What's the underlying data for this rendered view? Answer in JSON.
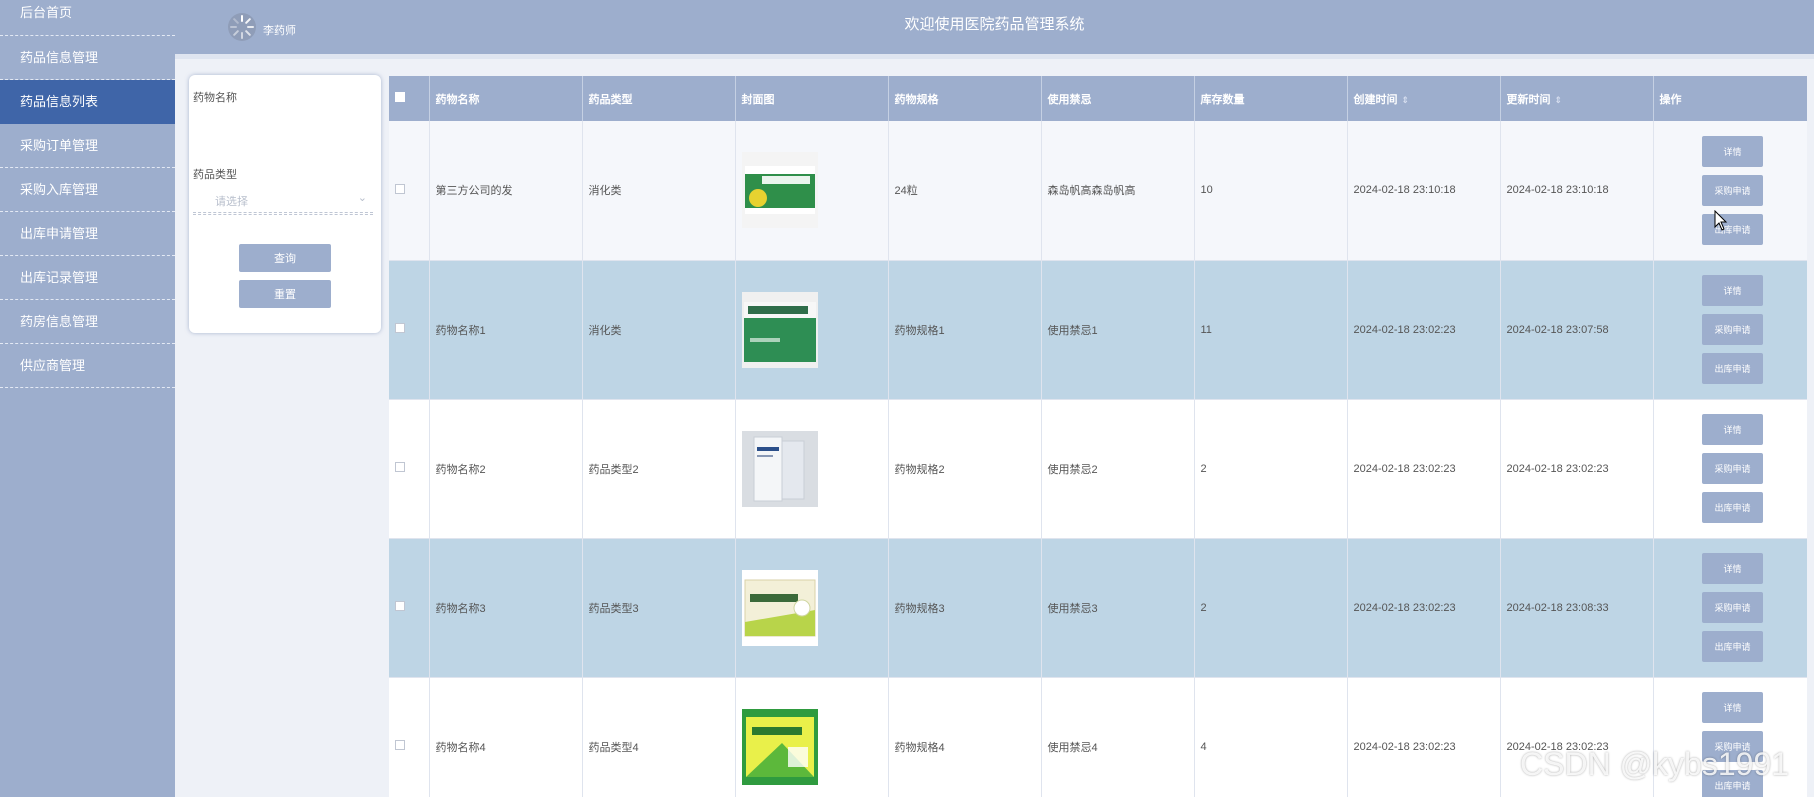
{
  "sidebar": {
    "items": [
      {
        "label": "后台首页",
        "active": false
      },
      {
        "label": "药品信息管理",
        "active": false
      },
      {
        "label": "药品信息列表",
        "active": true
      },
      {
        "label": "采购订单管理",
        "active": false
      },
      {
        "label": "采购入库管理",
        "active": false
      },
      {
        "label": "出库申请管理",
        "active": false
      },
      {
        "label": "出库记录管理",
        "active": false
      },
      {
        "label": "药房信息管理",
        "active": false
      },
      {
        "label": "供应商管理",
        "active": false
      }
    ]
  },
  "header": {
    "title": "欢迎使用医院药品管理系统",
    "username": "李药师"
  },
  "search": {
    "name_label": "药物名称",
    "name_value": "",
    "type_label": "药品类型",
    "type_placeholder": "请选择",
    "query_label": "查询",
    "reset_label": "重置"
  },
  "table": {
    "columns": [
      "药物名称",
      "药品类型",
      "封面图",
      "药物规格",
      "使用禁忌",
      "库存数量",
      "创建时间",
      "更新时间",
      "操作"
    ],
    "rows": [
      {
        "name": "第三方公司的发",
        "type": "消化类",
        "spec": "24粒",
        "taboo": "森岛帆高森岛帆高",
        "stock": "10",
        "created": "2024-02-18 23:10:18",
        "updated": "2024-02-18 23:10:18"
      },
      {
        "name": "药物名称1",
        "type": "消化类",
        "spec": "药物规格1",
        "taboo": "使用禁忌1",
        "stock": "11",
        "created": "2024-02-18 23:02:23",
        "updated": "2024-02-18 23:07:58"
      },
      {
        "name": "药物名称2",
        "type": "药品类型2",
        "spec": "药物规格2",
        "taboo": "使用禁忌2",
        "stock": "2",
        "created": "2024-02-18 23:02:23",
        "updated": "2024-02-18 23:02:23"
      },
      {
        "name": "药物名称3",
        "type": "药品类型3",
        "spec": "药物规格3",
        "taboo": "使用禁忌3",
        "stock": "2",
        "created": "2024-02-18 23:02:23",
        "updated": "2024-02-18 23:08:33"
      },
      {
        "name": "药物名称4",
        "type": "药品类型4",
        "spec": "药物规格4",
        "taboo": "使用禁忌4",
        "stock": "4",
        "created": "2024-02-18 23:02:23",
        "updated": "2024-02-18 23:02:23"
      }
    ],
    "actions": {
      "detail": "详情",
      "purchase": "采购申请",
      "outbound": "出库申请"
    }
  },
  "watermark": "CSDN @kybs1991",
  "colors": {
    "sidebar": "#9daecd",
    "active": "#3f65a8",
    "row_highlight": "#bed5e5",
    "button": "#9daecd"
  },
  "icons": [
    "loading-avatar-icon",
    "chevron-down-icon",
    "sort-icon",
    "mouse-cursor-icon"
  ]
}
